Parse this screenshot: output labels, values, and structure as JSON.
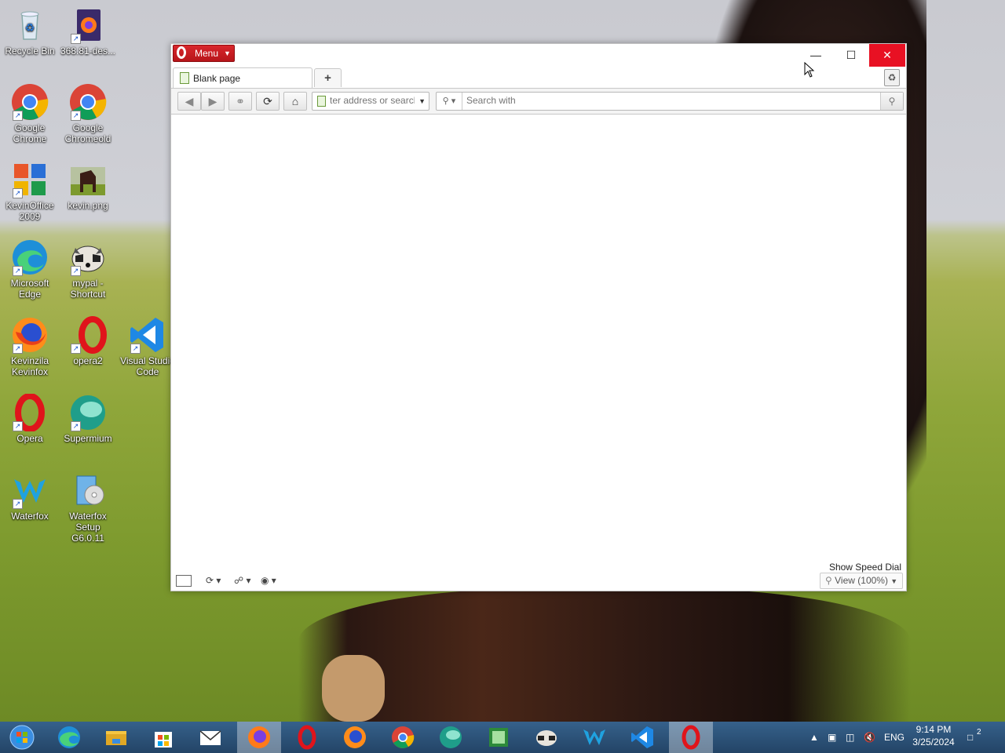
{
  "desktop": {
    "icons": [
      {
        "label": "Recycle Bin",
        "icon": "recycle-bin-icon"
      },
      {
        "label": "368.81-des...",
        "icon": "firefox-file-icon"
      },
      {
        "label": "Google\nChrome",
        "icon": "chrome-icon"
      },
      {
        "label": "Google\nChromeold",
        "icon": "chrome-old-icon"
      },
      {
        "label": "KevinOffice\n2009",
        "icon": "office-icon"
      },
      {
        "label": "kevin.png",
        "icon": "image-file-icon"
      },
      {
        "label": "Microsoft\nEdge",
        "icon": "edge-icon"
      },
      {
        "label": "mypal -\nShortcut",
        "icon": "mypal-icon"
      },
      {
        "label": "Kevinzila\nKevinfox",
        "icon": "firefox-icon"
      },
      {
        "label": "opera2",
        "icon": "opera-icon"
      },
      {
        "label": "Visual Studio\nCode",
        "icon": "vscode-icon"
      },
      {
        "label": "Opera",
        "icon": "opera-icon"
      },
      {
        "label": "Supermium",
        "icon": "supermium-icon"
      },
      {
        "label": "Waterfox",
        "icon": "waterfox-icon"
      },
      {
        "label": "Waterfox\nSetup G6.0.11",
        "icon": "installer-icon"
      }
    ]
  },
  "browser": {
    "menu_label": "Menu",
    "tab_title": "Blank page",
    "new_tab_symbol": "+",
    "address_placeholder": "ter address or search",
    "search_placeholder": "Search with",
    "show_speed_dial": "Show Speed Dial",
    "zoom_label": "View (100%)",
    "colors": {
      "menu": "#c41a1f",
      "close": "#e81123"
    }
  },
  "taskbar": {
    "items": [
      "start-orb-icon",
      "edge-icon",
      "file-explorer-icon",
      "store-icon",
      "mail-icon",
      "firefox-icon",
      "opera-icon",
      "firefox-icon",
      "chrome-icon",
      "supermium-icon",
      "office-icon",
      "mypal-icon",
      "waterfox-icon",
      "vscode-icon",
      "opera-icon"
    ],
    "language": "ENG",
    "time": "9:14 PM",
    "date": "3/25/2024",
    "notification_count": "2"
  }
}
